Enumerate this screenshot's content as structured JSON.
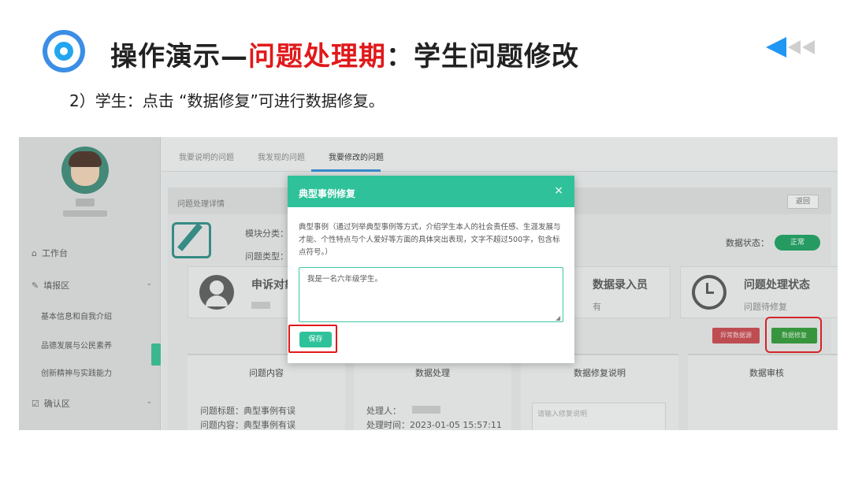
{
  "slide": {
    "title_part1": "操作演示—",
    "title_highlight": "问题处理期",
    "title_part2": "：学生问题修改",
    "subtitle": "2）学生：点击 “数据修复”可进行数据修复。"
  },
  "colors": {
    "accent_blue": "#2196f3",
    "highlight_red": "#e0191b",
    "modal_green": "#2fc29a"
  },
  "sidebar": {
    "items": [
      {
        "icon": "home-icon",
        "label": "工作台"
      },
      {
        "icon": "edit-icon",
        "label": "填报区"
      },
      {
        "label": "基本信息和自我介绍"
      },
      {
        "label": "品德发展与公民素养"
      },
      {
        "label": "创新精神与实践能力"
      },
      {
        "icon": "check-icon",
        "label": "确认区"
      }
    ]
  },
  "tabs": [
    "我要说明的问题",
    "我发现的问题",
    "我要修改的问题"
  ],
  "panel": {
    "title": "问题处理详情",
    "back_label": "返回",
    "module_label": "模块分类：初中",
    "type_label": "问题类型：数据",
    "data_status_label": "数据状态：",
    "data_status_value": "正常"
  },
  "cards": [
    {
      "title": "申诉对象"
    },
    {
      "title": "数据录入员",
      "sub": "有"
    },
    {
      "title": "问题处理状态",
      "sub": "问题待修复"
    }
  ],
  "actions": {
    "anomaly": "异常数据源",
    "repair": "数据修复"
  },
  "columns": {
    "c1": {
      "header": "问题内容",
      "line1": "问题标题：典型事例有误",
      "line2": "问题内容：典型事例有误"
    },
    "c2": {
      "header": "数据处理",
      "line1": "处理人：",
      "line2": "处理时间：2023-01-05 15:57:11"
    },
    "c3": {
      "header": "数据修复说明",
      "placeholder": "请输入修复说明"
    },
    "c4": {
      "header": "数据审核"
    }
  },
  "modal": {
    "title": "典型事例修复",
    "close": "×",
    "desc": "典型事例（通过列举典型事例等方式，介绍学生本人的社会责任感、生涯发展与才能、个性特点与个人爱好等方面的具体突出表现，文字不超过500字，包含标点符号。）",
    "text_value": "我是一名六年级学生。",
    "save_label": "保存"
  }
}
